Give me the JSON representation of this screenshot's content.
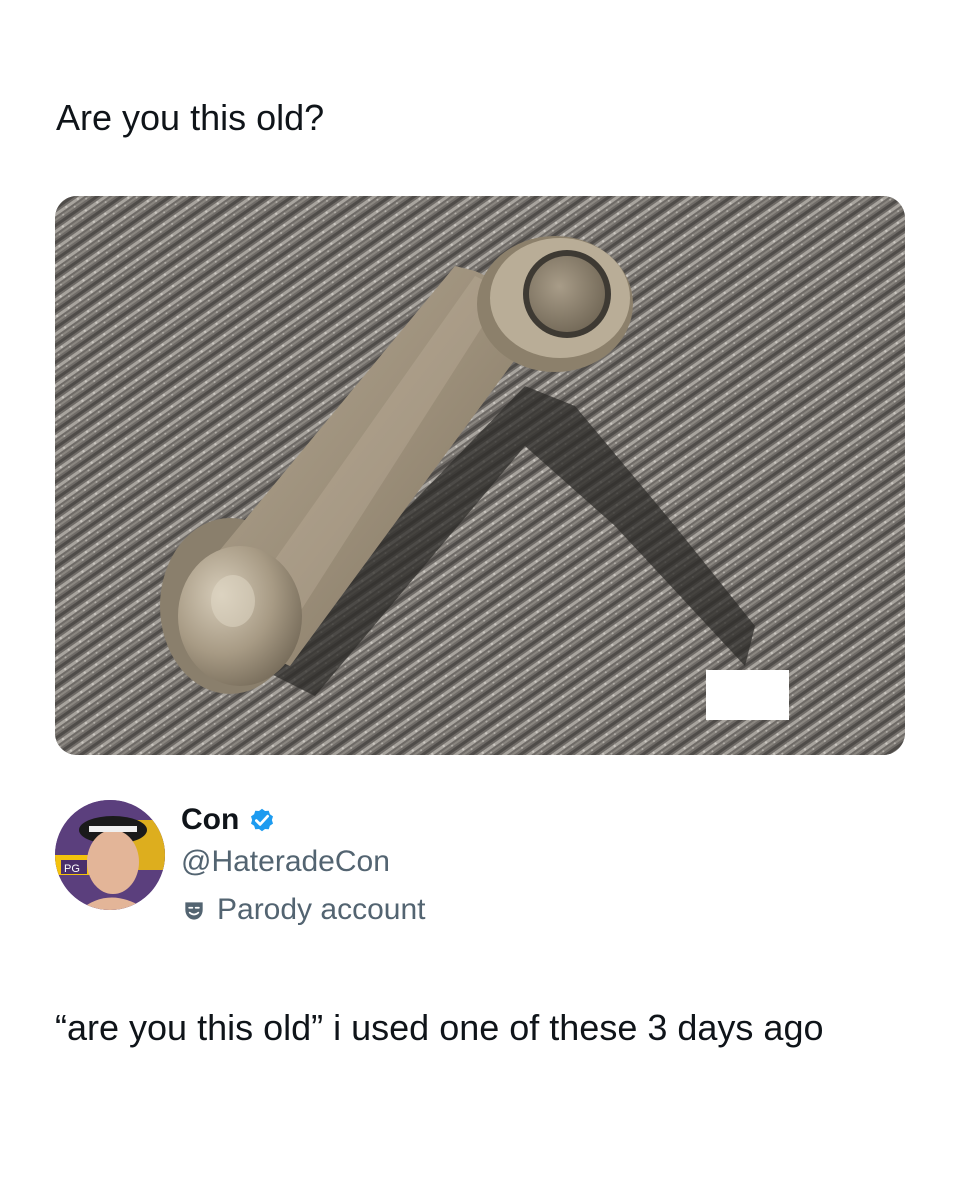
{
  "quoted_text": "Are you this old?",
  "media": {
    "subject": "window crank handle"
  },
  "author": {
    "name": "Con",
    "handle": "@HateradeCon",
    "badge_label": "Parody account",
    "verified_color": "#1d9bf0",
    "avatar_badge_text": "PG"
  },
  "post_text": "“are you this old” i used one of these 3 days ago"
}
